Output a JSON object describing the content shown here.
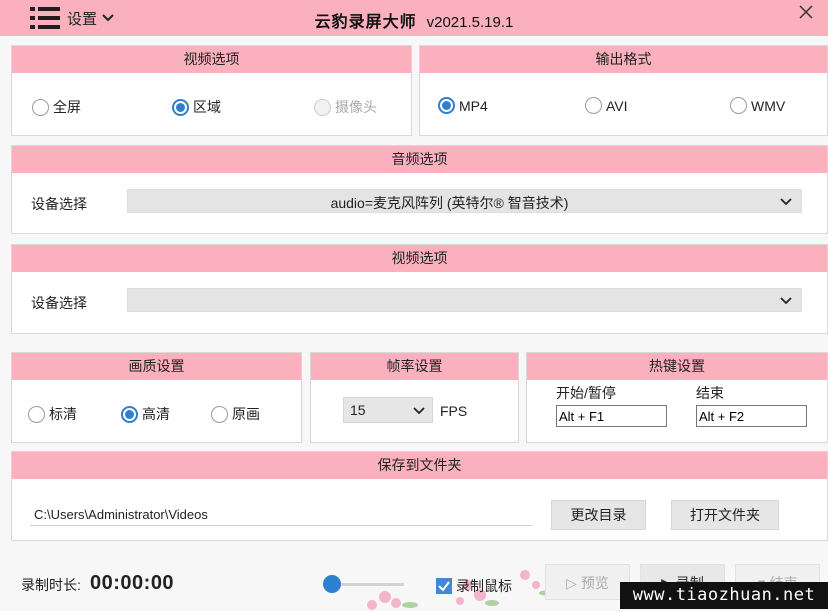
{
  "header": {
    "menu_label": "设置",
    "title": "云豹录屏大师",
    "version": "v2021.5.19.1"
  },
  "video_options": {
    "title": "视频选项",
    "options": [
      {
        "label": "全屏",
        "selected": false,
        "enabled": true
      },
      {
        "label": "区域",
        "selected": true,
        "enabled": true
      },
      {
        "label": "摄像头",
        "selected": false,
        "enabled": false
      }
    ]
  },
  "output_format": {
    "title": "输出格式",
    "options": [
      {
        "label": "MP4",
        "selected": true
      },
      {
        "label": "AVI",
        "selected": false
      },
      {
        "label": "WMV",
        "selected": false
      }
    ]
  },
  "audio_options": {
    "title": "音频选项",
    "device_label": "设备选择",
    "device_value": "audio=麦克风阵列 (英特尔® 智音技术)"
  },
  "video_device": {
    "title": "视频选项",
    "device_label": "设备选择",
    "device_value": ""
  },
  "quality": {
    "title": "画质设置",
    "options": [
      {
        "label": "标清",
        "selected": false
      },
      {
        "label": "高清",
        "selected": true
      },
      {
        "label": "原画",
        "selected": false
      }
    ]
  },
  "framerate": {
    "title": "帧率设置",
    "value": "15",
    "unit": "FPS"
  },
  "hotkeys": {
    "title": "热键设置",
    "start_label": "开始/暂停",
    "start_value": "Alt + F1",
    "stop_label": "结束",
    "stop_value": "Alt + F2"
  },
  "save_folder": {
    "title": "保存到文件夹",
    "path": "C:\\Users\\Administrator\\Videos",
    "change_button": "更改目录",
    "open_button": "打开文件夹"
  },
  "footer": {
    "duration_label": "录制时长:",
    "duration_value": "00:00:00",
    "volume_level": 0.05,
    "record_mouse_label": "录制鼠标",
    "record_mouse_checked": true,
    "preview_button": "预览",
    "record_button": "录制",
    "stop_button": "结束"
  },
  "watermark": "www.tiaozhuan.net",
  "colors": {
    "header_pink": "#fbb1bd",
    "accent_blue": "#2f7fd0"
  }
}
